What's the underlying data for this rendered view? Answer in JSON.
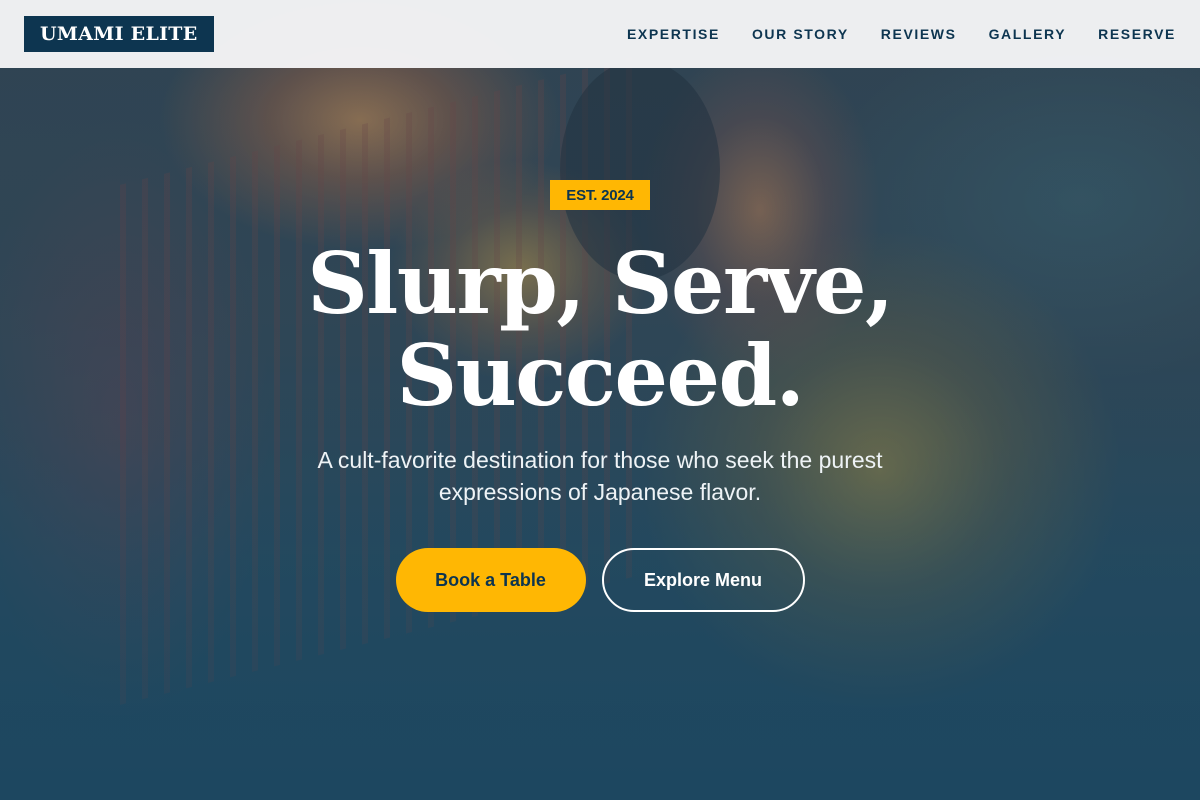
{
  "header": {
    "logo": "UMAMI ELITE",
    "nav": [
      "EXPERTISE",
      "OUR STORY",
      "REVIEWS",
      "GALLERY",
      "RESERVE"
    ]
  },
  "hero": {
    "badge": "EST. 2024",
    "headline_line1": "Slurp, Serve,",
    "headline_line2": "Succeed.",
    "subtitle": "A cult-favorite destination for those who seek the purest expressions of Japanese flavor.",
    "primary_cta": "Book a Table",
    "secondary_cta": "Explore Menu"
  },
  "colors": {
    "brand_navy": "#0d3550",
    "accent_yellow": "#ffb703"
  }
}
